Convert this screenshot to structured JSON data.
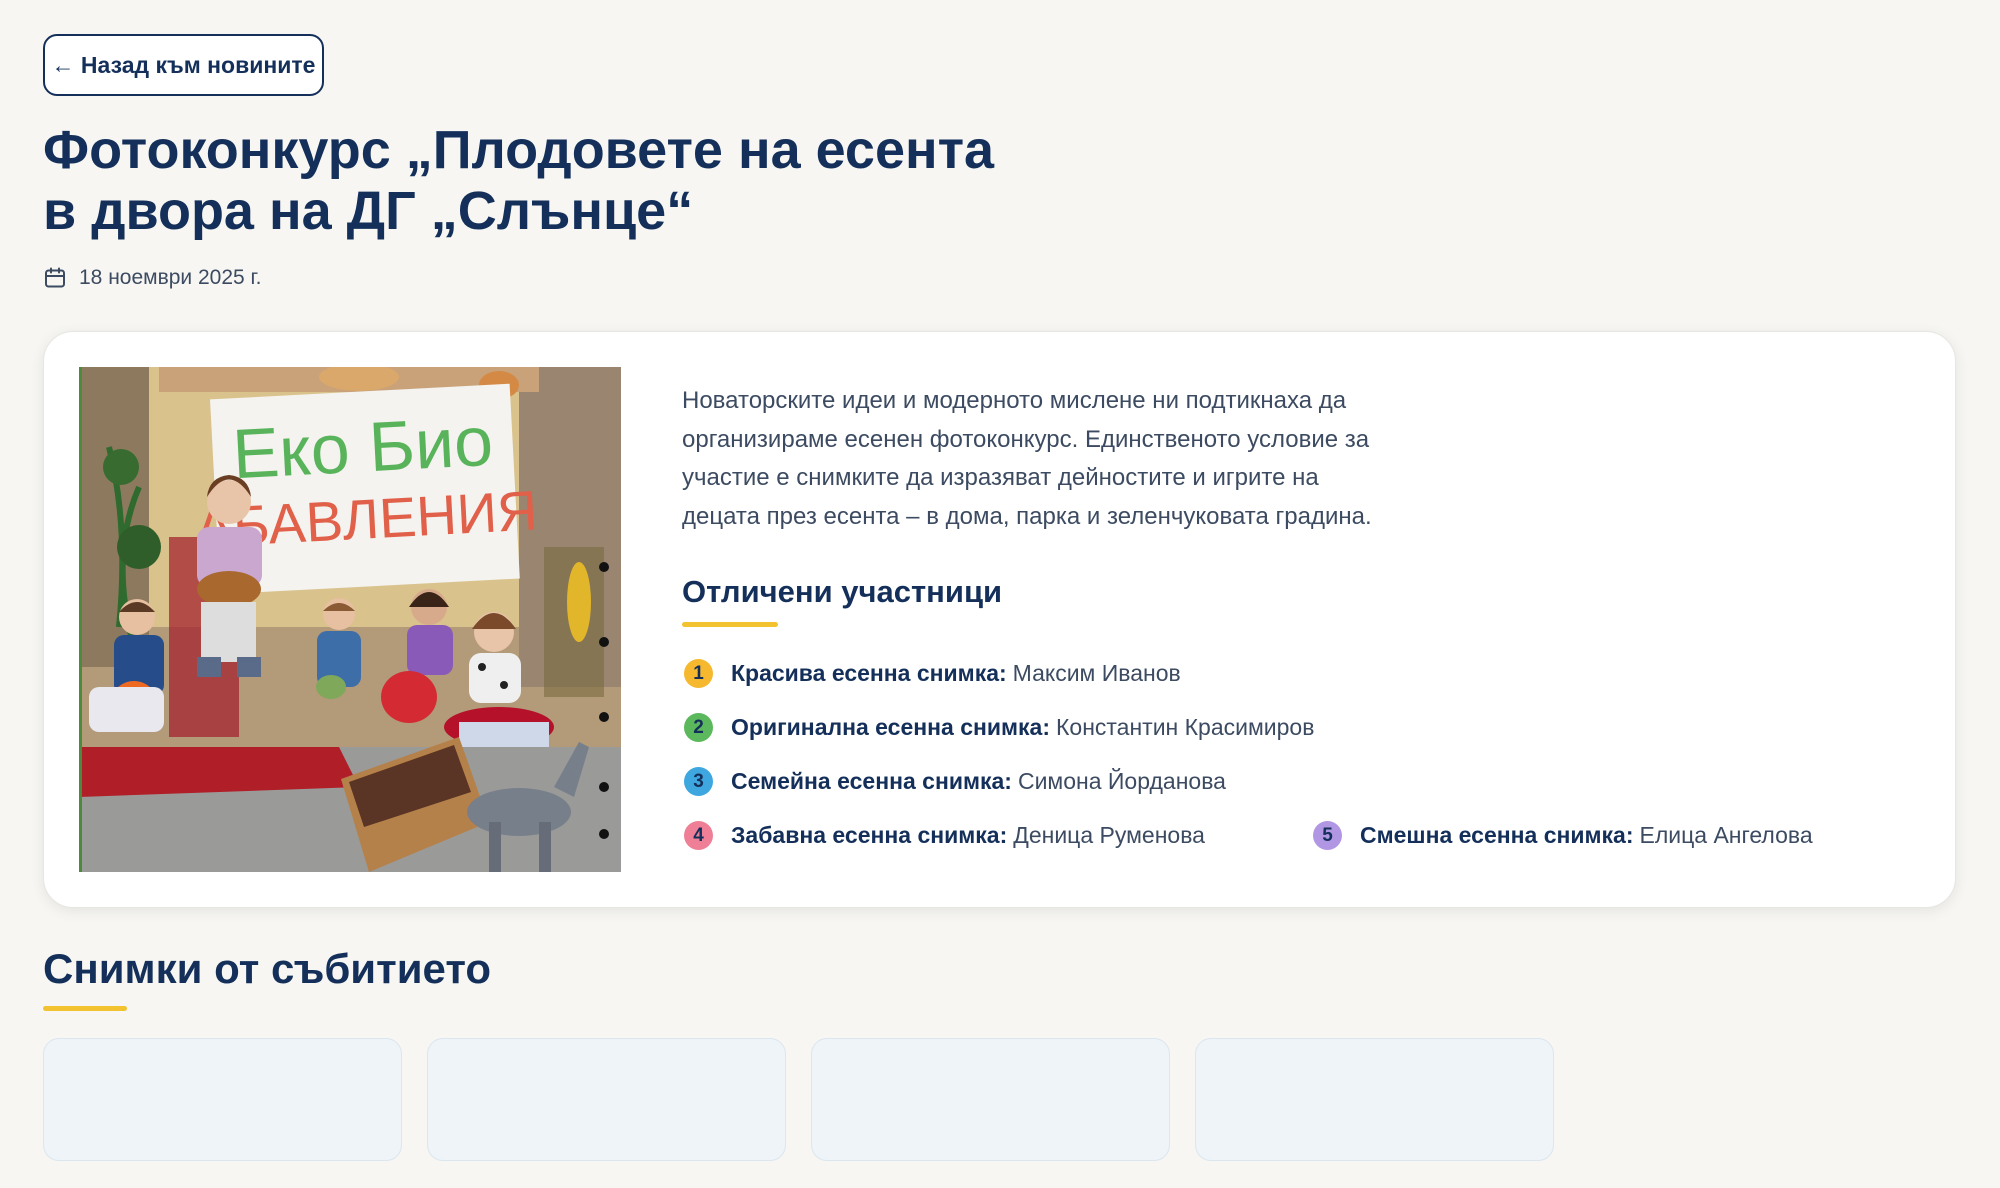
{
  "nav": {
    "back_label": "← Назад към новините"
  },
  "article": {
    "title_line1": "Фотоконкурс „Плодовете на есента",
    "title_line2": "в двора на ДГ „Слънце“",
    "date": "18 ноември 2025 г.",
    "description": "Новаторските идеи и модерното мислене ни подтикнаха да организираме есенен фотоконкурс. Единственото условие за участие е снимките да изразяват дейностите и игрите на децата през есента – в дома, парка и зеленчуковата градина.",
    "photo_banner_line1": "Еко Био",
    "photo_banner_line2": "АБАВЛЕНИЯ"
  },
  "winners": {
    "heading": "Отличени участници",
    "items": [
      {
        "num": "1",
        "category": "Красива есенна снимка:",
        "name": "Максим Иванов",
        "color": "#f5b82e"
      },
      {
        "num": "2",
        "category": "Оригинална есенна снимка:",
        "name": "Константин Красимиров",
        "color": "#5cb85c"
      },
      {
        "num": "3",
        "category": "Семейна есенна снимка:",
        "name": "Симона Йорданова",
        "color": "#3ea7e0"
      },
      {
        "num": "4",
        "category": "Забавна есенна снимка:",
        "name": "Деница Руменова",
        "color": "#ee7f97"
      },
      {
        "num": "5",
        "category": "Смешна есенна снимка:",
        "name": "Елица Ангелова",
        "color": "#b197e3"
      }
    ]
  },
  "gallery": {
    "heading": "Снимки от събитието"
  },
  "colors": {
    "primary": "#14305a",
    "accent": "#f2c230",
    "background": "#f7f6f2"
  },
  "icons": {
    "date": "calendar-icon"
  }
}
